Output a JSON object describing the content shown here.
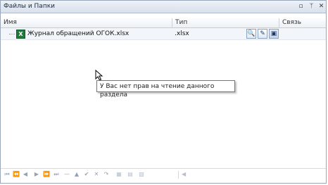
{
  "window": {
    "title": "Файлы и Папки"
  },
  "titlebar_buttons": [
    {
      "icon": "restore-icon",
      "glyph": "▫"
    },
    {
      "icon": "pin-icon",
      "glyph": "ᛘ"
    },
    {
      "icon": "close-icon",
      "glyph": "✕"
    }
  ],
  "table": {
    "columns": [
      "Имя",
      "Тип",
      "Связь"
    ],
    "rows": [
      {
        "name": "Журнал обращений ОГОК.xlsx",
        "type": ".xlsx",
        "icon": "excel-file-icon",
        "icon_glyph": "X"
      }
    ],
    "row_actions": [
      {
        "name": "preview-button",
        "glyph": "🔍"
      },
      {
        "name": "edit-button",
        "glyph": "✎"
      },
      {
        "name": "save-button",
        "glyph": "▣"
      }
    ]
  },
  "tooltip": {
    "text": "У Вас нет прав на чтение данного раздела"
  },
  "navigator": {
    "buttons": [
      {
        "name": "first-page-icon",
        "glyph": "⏮"
      },
      {
        "name": "prev-page-icon",
        "glyph": "⏪"
      },
      {
        "name": "prev-record-icon",
        "glyph": "◀"
      },
      {
        "name": "next-record-icon",
        "glyph": "▶"
      },
      {
        "name": "next-page-icon",
        "glyph": "⏩"
      },
      {
        "name": "last-page-icon",
        "glyph": "⏭"
      },
      {
        "name": "delete-icon",
        "glyph": "—"
      },
      {
        "name": "edit-icon",
        "glyph": "▲"
      },
      {
        "name": "post-icon",
        "glyph": "✔"
      },
      {
        "name": "cancel-icon",
        "glyph": "✕"
      },
      {
        "name": "refresh-icon",
        "glyph": "↷"
      },
      {
        "name": "add-file-icon",
        "glyph": "▦"
      },
      {
        "name": "add-folder-icon",
        "glyph": "▤"
      },
      {
        "name": "remove-file-icon",
        "glyph": "▧"
      }
    ],
    "scroll_left_glyph": "◀"
  }
}
